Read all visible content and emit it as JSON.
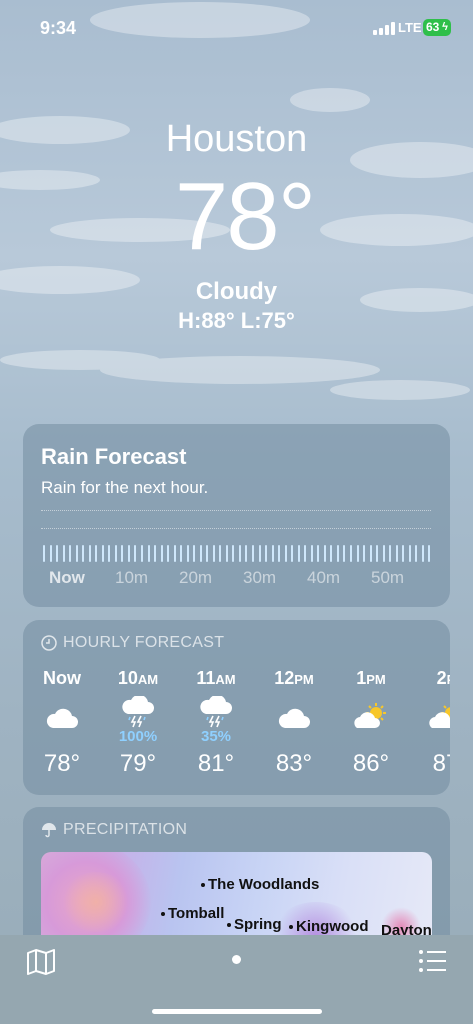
{
  "status_bar": {
    "time": "9:34",
    "network": "LTE",
    "battery": "63"
  },
  "location": {
    "city": "Houston",
    "temperature": "78°",
    "condition": "Cloudy",
    "high_low": "H:88°  L:75°"
  },
  "rain_forecast": {
    "title": "Rain Forecast",
    "summary": "Rain for the next hour.",
    "ticks": [
      "Now",
      "10m",
      "20m",
      "30m",
      "40m",
      "50m"
    ]
  },
  "hourly": {
    "header": "HOURLY FORECAST",
    "items": [
      {
        "hour": "Now",
        "suffix": "",
        "icon": "cloud-icon",
        "precip": "",
        "temp": "78°"
      },
      {
        "hour": "10",
        "suffix": "AM",
        "icon": "thunderstorm-icon",
        "precip": "100%",
        "temp": "79°"
      },
      {
        "hour": "11",
        "suffix": "AM",
        "icon": "thunderstorm-icon",
        "precip": "35%",
        "temp": "81°"
      },
      {
        "hour": "12",
        "suffix": "PM",
        "icon": "cloud-icon",
        "precip": "",
        "temp": "83°"
      },
      {
        "hour": "1",
        "suffix": "PM",
        "icon": "partly-sunny-icon",
        "precip": "",
        "temp": "86°"
      },
      {
        "hour": "2",
        "suffix": "P",
        "icon": "partly-sunny-icon",
        "precip": "",
        "temp": "87"
      }
    ]
  },
  "precipitation": {
    "header": "PRECIPITATION",
    "map_labels": [
      "The Woodlands",
      "Tomball",
      "Spring",
      "Kingwood",
      "Dayton"
    ]
  },
  "toolbar": {
    "left_icon": "map-icon",
    "right_icon": "list-icon"
  }
}
